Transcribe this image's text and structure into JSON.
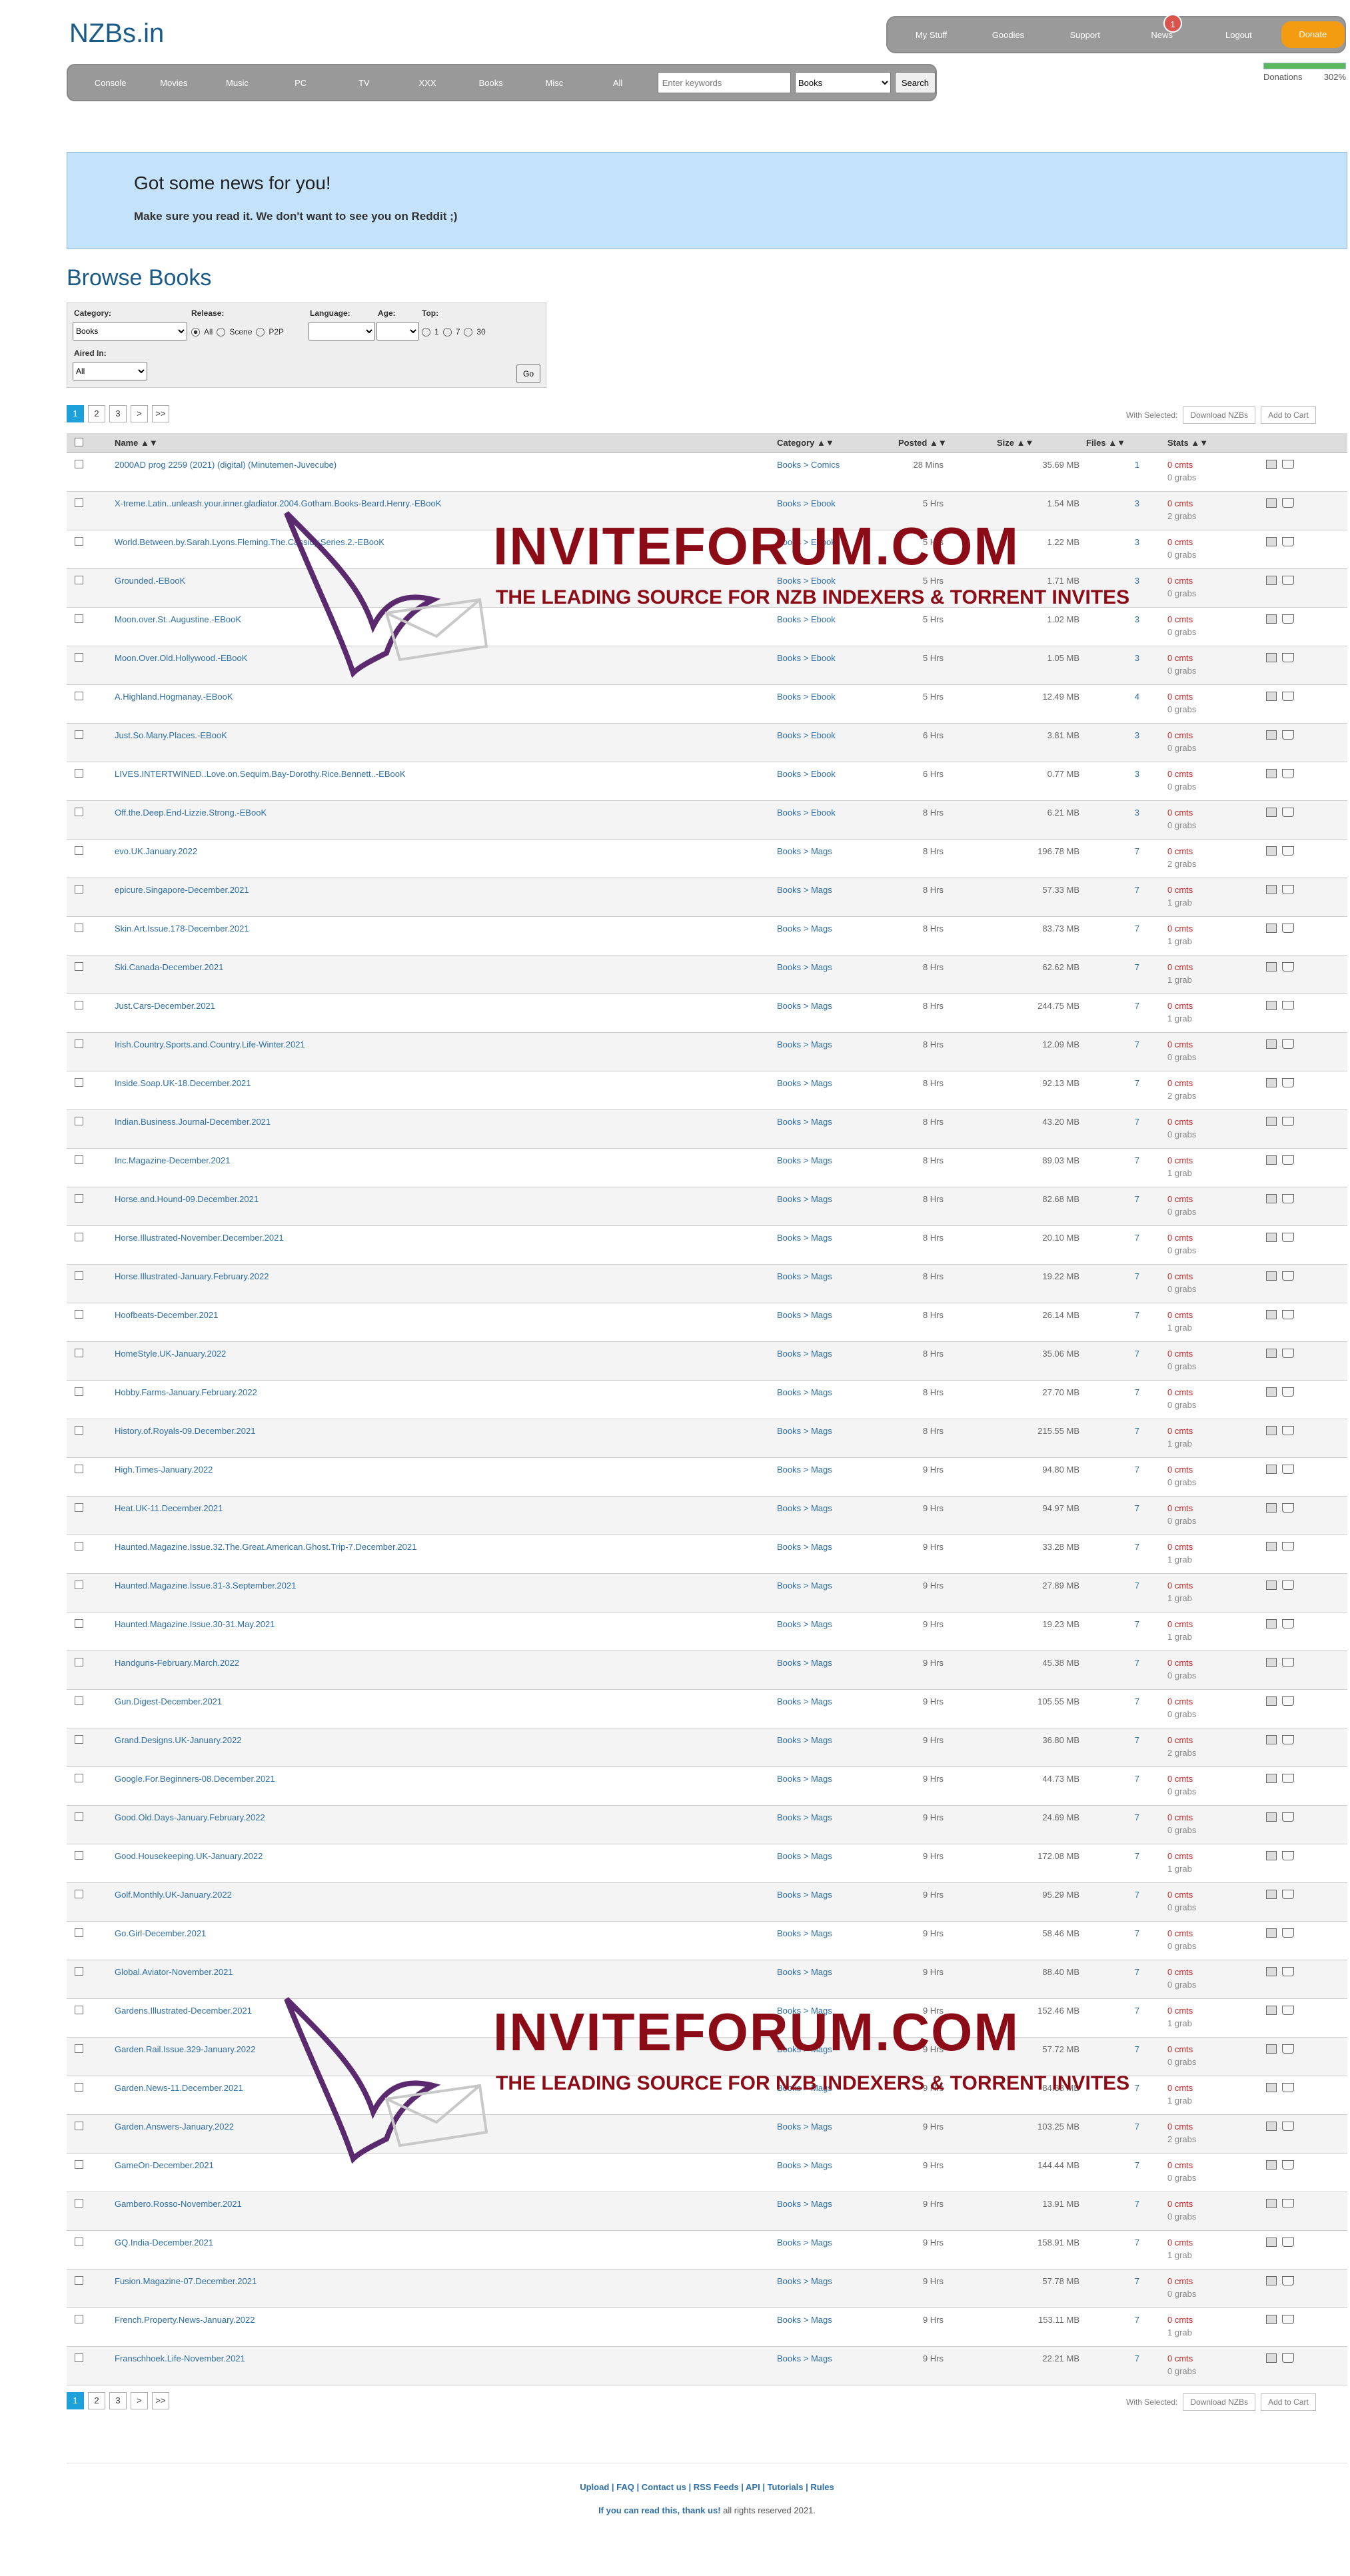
{
  "logo": "NZBs.in",
  "topnav": {
    "items": [
      "My Stuff",
      "Goodies",
      "Support",
      "News",
      "Logout"
    ],
    "news_badge": "1",
    "donate": "Donate"
  },
  "donations": {
    "label": "Donations",
    "percent": "302%",
    "progress_fraction": 1.0
  },
  "catnav": {
    "items": [
      "Console",
      "Movies",
      "Music",
      "PC",
      "TV",
      "XXX",
      "Books",
      "Misc",
      "All"
    ],
    "search_placeholder": "Enter keywords",
    "search_category": "Books",
    "search_button": "Search"
  },
  "news": {
    "title": "Got some news for you!",
    "body": "Make sure you read it. We don't want to see you on Reddit ;)"
  },
  "page_title": "Browse Books",
  "filters": {
    "category_label": "Category:",
    "category_value": "Books",
    "release_label": "Release:",
    "release_options": [
      "All",
      "Scene",
      "P2P"
    ],
    "language_label": "Language:",
    "age_label": "Age:",
    "top_label": "Top:",
    "top_options": [
      "1",
      "7",
      "30"
    ],
    "aired_label": "Aired In:",
    "aired_value": "All",
    "go": "Go"
  },
  "pager": [
    "1",
    "2",
    "3",
    ">",
    ">>"
  ],
  "selected_actions": {
    "label": "With Selected:",
    "download": "Download NZBs",
    "cart": "Add to Cart"
  },
  "columns": {
    "name": "Name ▲▼",
    "category": "Category ▲▼",
    "posted": "Posted ▲▼",
    "size": "Size ▲▼",
    "files": "Files ▲▼",
    "stats": "Stats ▲▼"
  },
  "rows": [
    {
      "name": "2000AD prog 2259 (2021) (digital) (Minutemen-Juvecube)",
      "category": "Books > Comics",
      "posted": "28 Mins",
      "size": "35.69 MB",
      "files": "1",
      "comments": "0 cmts",
      "grabs": "0 grabs"
    },
    {
      "name": "X-treme.Latin..unleash.your.inner.gladiator.2004.Gotham.Books-Beard.Henry.-EBooK",
      "category": "Books > Ebook",
      "posted": "5 Hrs",
      "size": "1.54 MB",
      "files": "3",
      "comments": "0 cmts",
      "grabs": "2 grabs"
    },
    {
      "name": "World.Between.by.Sarah.Lyons.Fleming.The.Cassidy.Series.2.-EBooK",
      "category": "Books > Ebook",
      "posted": "5 Hrs",
      "size": "1.22 MB",
      "files": "3",
      "comments": "0 cmts",
      "grabs": "0 grabs"
    },
    {
      "name": "Grounded.-EBooK",
      "category": "Books > Ebook",
      "posted": "5 Hrs",
      "size": "1.71 MB",
      "files": "3",
      "comments": "0 cmts",
      "grabs": "0 grabs"
    },
    {
      "name": "Moon.over.St..Augustine.-EBooK",
      "category": "Books > Ebook",
      "posted": "5 Hrs",
      "size": "1.02 MB",
      "files": "3",
      "comments": "0 cmts",
      "grabs": "0 grabs"
    },
    {
      "name": "Moon.Over.Old.Hollywood.-EBooK",
      "category": "Books > Ebook",
      "posted": "5 Hrs",
      "size": "1.05 MB",
      "files": "3",
      "comments": "0 cmts",
      "grabs": "0 grabs"
    },
    {
      "name": "A.Highland.Hogmanay.-EBooK",
      "category": "Books > Ebook",
      "posted": "5 Hrs",
      "size": "12.49 MB",
      "files": "4",
      "comments": "0 cmts",
      "grabs": "0 grabs"
    },
    {
      "name": "Just.So.Many.Places.-EBooK",
      "category": "Books > Ebook",
      "posted": "6 Hrs",
      "size": "3.81 MB",
      "files": "3",
      "comments": "0 cmts",
      "grabs": "0 grabs"
    },
    {
      "name": "LIVES.INTERTWINED..Love.on.Sequim.Bay-Dorothy.Rice.Bennett..-EBooK",
      "category": "Books > Ebook",
      "posted": "6 Hrs",
      "size": "0.77 MB",
      "files": "3",
      "comments": "0 cmts",
      "grabs": "0 grabs"
    },
    {
      "name": "Off.the.Deep.End-Lizzie.Strong.-EBooK",
      "category": "Books > Ebook",
      "posted": "8 Hrs",
      "size": "6.21 MB",
      "files": "3",
      "comments": "0 cmts",
      "grabs": "0 grabs"
    },
    {
      "name": "evo.UK.January.2022",
      "category": "Books > Mags",
      "posted": "8 Hrs",
      "size": "196.78 MB",
      "files": "7",
      "comments": "0 cmts",
      "grabs": "2 grabs"
    },
    {
      "name": "epicure.Singapore-December.2021",
      "category": "Books > Mags",
      "posted": "8 Hrs",
      "size": "57.33 MB",
      "files": "7",
      "comments": "0 cmts",
      "grabs": "1 grab"
    },
    {
      "name": "Skin.Art.Issue.178-December.2021",
      "category": "Books > Mags",
      "posted": "8 Hrs",
      "size": "83.73 MB",
      "files": "7",
      "comments": "0 cmts",
      "grabs": "1 grab"
    },
    {
      "name": "Ski.Canada-December.2021",
      "category": "Books > Mags",
      "posted": "8 Hrs",
      "size": "62.62 MB",
      "files": "7",
      "comments": "0 cmts",
      "grabs": "1 grab"
    },
    {
      "name": "Just.Cars-December.2021",
      "category": "Books > Mags",
      "posted": "8 Hrs",
      "size": "244.75 MB",
      "files": "7",
      "comments": "0 cmts",
      "grabs": "1 grab"
    },
    {
      "name": "Irish.Country.Sports.and.Country.Life-Winter.2021",
      "category": "Books > Mags",
      "posted": "8 Hrs",
      "size": "12.09 MB",
      "files": "7",
      "comments": "0 cmts",
      "grabs": "0 grabs"
    },
    {
      "name": "Inside.Soap.UK-18.December.2021",
      "category": "Books > Mags",
      "posted": "8 Hrs",
      "size": "92.13 MB",
      "files": "7",
      "comments": "0 cmts",
      "grabs": "2 grabs"
    },
    {
      "name": "Indian.Business.Journal-December.2021",
      "category": "Books > Mags",
      "posted": "8 Hrs",
      "size": "43.20 MB",
      "files": "7",
      "comments": "0 cmts",
      "grabs": "0 grabs"
    },
    {
      "name": "Inc.Magazine-December.2021",
      "category": "Books > Mags",
      "posted": "8 Hrs",
      "size": "89.03 MB",
      "files": "7",
      "comments": "0 cmts",
      "grabs": "1 grab"
    },
    {
      "name": "Horse.and.Hound-09.December.2021",
      "category": "Books > Mags",
      "posted": "8 Hrs",
      "size": "82.68 MB",
      "files": "7",
      "comments": "0 cmts",
      "grabs": "0 grabs"
    },
    {
      "name": "Horse.Illustrated-November.December.2021",
      "category": "Books > Mags",
      "posted": "8 Hrs",
      "size": "20.10 MB",
      "files": "7",
      "comments": "0 cmts",
      "grabs": "0 grabs"
    },
    {
      "name": "Horse.Illustrated-January.February.2022",
      "category": "Books > Mags",
      "posted": "8 Hrs",
      "size": "19.22 MB",
      "files": "7",
      "comments": "0 cmts",
      "grabs": "0 grabs"
    },
    {
      "name": "Hoofbeats-December.2021",
      "category": "Books > Mags",
      "posted": "8 Hrs",
      "size": "26.14 MB",
      "files": "7",
      "comments": "0 cmts",
      "grabs": "1 grab"
    },
    {
      "name": "HomeStyle.UK-January.2022",
      "category": "Books > Mags",
      "posted": "8 Hrs",
      "size": "35.06 MB",
      "files": "7",
      "comments": "0 cmts",
      "grabs": "0 grabs"
    },
    {
      "name": "Hobby.Farms-January.February.2022",
      "category": "Books > Mags",
      "posted": "8 Hrs",
      "size": "27.70 MB",
      "files": "7",
      "comments": "0 cmts",
      "grabs": "0 grabs"
    },
    {
      "name": "History.of.Royals-09.December.2021",
      "category": "Books > Mags",
      "posted": "8 Hrs",
      "size": "215.55 MB",
      "files": "7",
      "comments": "0 cmts",
      "grabs": "1 grab"
    },
    {
      "name": "High.Times-January.2022",
      "category": "Books > Mags",
      "posted": "9 Hrs",
      "size": "94.80 MB",
      "files": "7",
      "comments": "0 cmts",
      "grabs": "0 grabs"
    },
    {
      "name": "Heat.UK-11.December.2021",
      "category": "Books > Mags",
      "posted": "9 Hrs",
      "size": "94.97 MB",
      "files": "7",
      "comments": "0 cmts",
      "grabs": "0 grabs"
    },
    {
      "name": "Haunted.Magazine.Issue.32.The.Great.American.Ghost.Trip-7.December.2021",
      "category": "Books > Mags",
      "posted": "9 Hrs",
      "size": "33.28 MB",
      "files": "7",
      "comments": "0 cmts",
      "grabs": "1 grab"
    },
    {
      "name": "Haunted.Magazine.Issue.31-3.September.2021",
      "category": "Books > Mags",
      "posted": "9 Hrs",
      "size": "27.89 MB",
      "files": "7",
      "comments": "0 cmts",
      "grabs": "1 grab"
    },
    {
      "name": "Haunted.Magazine.Issue.30-31.May.2021",
      "category": "Books > Mags",
      "posted": "9 Hrs",
      "size": "19.23 MB",
      "files": "7",
      "comments": "0 cmts",
      "grabs": "1 grab"
    },
    {
      "name": "Handguns-February.March.2022",
      "category": "Books > Mags",
      "posted": "9 Hrs",
      "size": "45.38 MB",
      "files": "7",
      "comments": "0 cmts",
      "grabs": "0 grabs"
    },
    {
      "name": "Gun.Digest-December.2021",
      "category": "Books > Mags",
      "posted": "9 Hrs",
      "size": "105.55 MB",
      "files": "7",
      "comments": "0 cmts",
      "grabs": "0 grabs"
    },
    {
      "name": "Grand.Designs.UK-January.2022",
      "category": "Books > Mags",
      "posted": "9 Hrs",
      "size": "36.80 MB",
      "files": "7",
      "comments": "0 cmts",
      "grabs": "2 grabs"
    },
    {
      "name": "Google.For.Beginners-08.December.2021",
      "category": "Books > Mags",
      "posted": "9 Hrs",
      "size": "44.73 MB",
      "files": "7",
      "comments": "0 cmts",
      "grabs": "0 grabs"
    },
    {
      "name": "Good.Old.Days-January.February.2022",
      "category": "Books > Mags",
      "posted": "9 Hrs",
      "size": "24.69 MB",
      "files": "7",
      "comments": "0 cmts",
      "grabs": "0 grabs"
    },
    {
      "name": "Good.Housekeeping.UK-January.2022",
      "category": "Books > Mags",
      "posted": "9 Hrs",
      "size": "172.08 MB",
      "files": "7",
      "comments": "0 cmts",
      "grabs": "1 grab"
    },
    {
      "name": "Golf.Monthly.UK-January.2022",
      "category": "Books > Mags",
      "posted": "9 Hrs",
      "size": "95.29 MB",
      "files": "7",
      "comments": "0 cmts",
      "grabs": "0 grabs"
    },
    {
      "name": "Go.Girl-December.2021",
      "category": "Books > Mags",
      "posted": "9 Hrs",
      "size": "58.46 MB",
      "files": "7",
      "comments": "0 cmts",
      "grabs": "0 grabs"
    },
    {
      "name": "Global.Aviator-November.2021",
      "category": "Books > Mags",
      "posted": "9 Hrs",
      "size": "88.40 MB",
      "files": "7",
      "comments": "0 cmts",
      "grabs": "0 grabs"
    },
    {
      "name": "Gardens.Illustrated-December.2021",
      "category": "Books > Mags",
      "posted": "9 Hrs",
      "size": "152.46 MB",
      "files": "7",
      "comments": "0 cmts",
      "grabs": "1 grab"
    },
    {
      "name": "Garden.Rail.Issue.329-January.2022",
      "category": "Books > Mags",
      "posted": "9 Hrs",
      "size": "57.72 MB",
      "files": "7",
      "comments": "0 cmts",
      "grabs": "0 grabs"
    },
    {
      "name": "Garden.News-11.December.2021",
      "category": "Books > Mags",
      "posted": "9 Hrs",
      "size": "84.38 MB",
      "files": "7",
      "comments": "0 cmts",
      "grabs": "1 grab"
    },
    {
      "name": "Garden.Answers-January.2022",
      "category": "Books > Mags",
      "posted": "9 Hrs",
      "size": "103.25 MB",
      "files": "7",
      "comments": "0 cmts",
      "grabs": "2 grabs"
    },
    {
      "name": "GameOn-December.2021",
      "category": "Books > Mags",
      "posted": "9 Hrs",
      "size": "144.44 MB",
      "files": "7",
      "comments": "0 cmts",
      "grabs": "0 grabs"
    },
    {
      "name": "Gambero.Rosso-November.2021",
      "category": "Books > Mags",
      "posted": "9 Hrs",
      "size": "13.91 MB",
      "files": "7",
      "comments": "0 cmts",
      "grabs": "0 grabs"
    },
    {
      "name": "GQ.India-December.2021",
      "category": "Books > Mags",
      "posted": "9 Hrs",
      "size": "158.91 MB",
      "files": "7",
      "comments": "0 cmts",
      "grabs": "1 grab"
    },
    {
      "name": "Fusion.Magazine-07.December.2021",
      "category": "Books > Mags",
      "posted": "9 Hrs",
      "size": "57.78 MB",
      "files": "7",
      "comments": "0 cmts",
      "grabs": "0 grabs"
    },
    {
      "name": "French.Property.News-January.2022",
      "category": "Books > Mags",
      "posted": "9 Hrs",
      "size": "153.11 MB",
      "files": "7",
      "comments": "0 cmts",
      "grabs": "1 grab"
    },
    {
      "name": "Franschhoek.Life-November.2021",
      "category": "Books > Mags",
      "posted": "9 Hrs",
      "size": "22.21 MB",
      "files": "7",
      "comments": "0 cmts",
      "grabs": "0 grabs"
    }
  ],
  "footer": {
    "links": "Upload | FAQ | Contact us | RSS Feeds | API | Tutorials | Rules",
    "thanks": "If you can read this, thank us!",
    "rights": "all rights reserved 2021."
  },
  "watermark": {
    "title": "INVITEFORUM.COM",
    "tagline": "THE LEADING SOURCE FOR NZB INDEXERS & TORRENT INVITES"
  },
  "colors": {
    "accent": "#1a5a86",
    "link": "#2d6ea6",
    "donate": "#f39c12",
    "news_bg": "#c4e3fb",
    "watermark": "#8b0b16"
  }
}
